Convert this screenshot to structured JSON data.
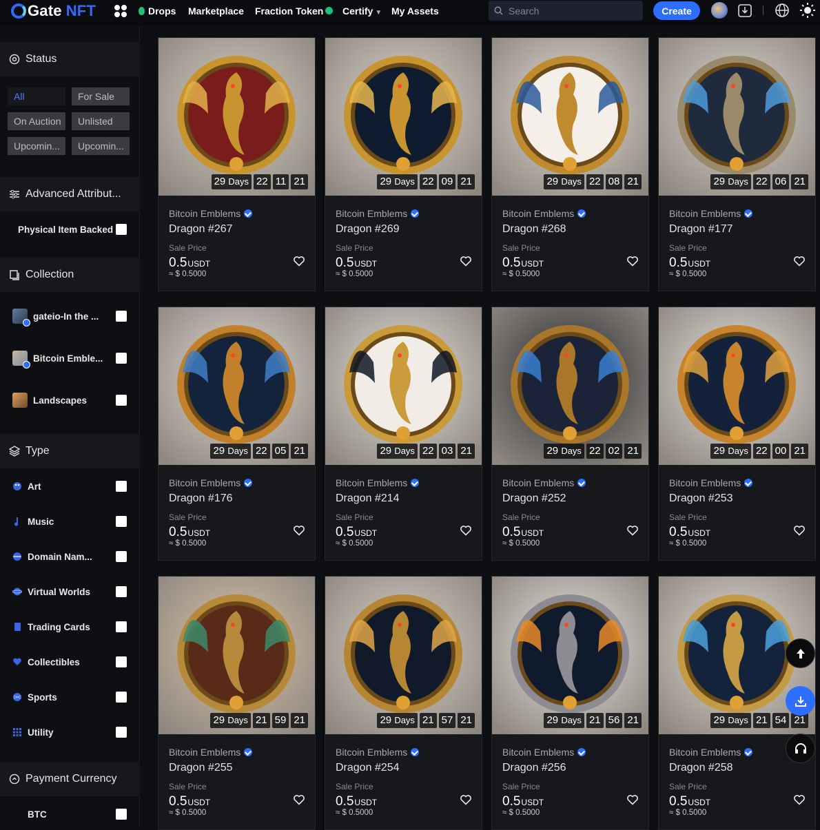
{
  "header": {
    "logo_main": "Gate",
    "logo_sub": "NFT",
    "nav": [
      {
        "label": "Drops"
      },
      {
        "label": "Marketplace"
      },
      {
        "label": "Fraction Token"
      },
      {
        "label": "Certify"
      },
      {
        "label": "My Assets"
      }
    ],
    "search_placeholder": "Search",
    "create_label": "Create"
  },
  "sidebar": {
    "status": {
      "title": "Status",
      "chips": [
        {
          "label": "All",
          "active": true
        },
        {
          "label": "For Sale",
          "active": false
        },
        {
          "label": "On Auction",
          "active": false
        },
        {
          "label": "Unlisted",
          "active": false
        },
        {
          "label": "Upcomin...",
          "active": false
        },
        {
          "label": "Upcomin...",
          "active": false
        }
      ]
    },
    "advanced": {
      "title": "Advanced Attribut...",
      "items": [
        {
          "label": "Physical Item Backed"
        }
      ]
    },
    "collection": {
      "title": "Collection",
      "items": [
        {
          "label": "gateio-In the ..."
        },
        {
          "label": "Bitcoin Emble..."
        },
        {
          "label": "Landscapes"
        }
      ]
    },
    "type": {
      "title": "Type",
      "items": [
        {
          "label": "Art"
        },
        {
          "label": "Music"
        },
        {
          "label": "Domain Nam..."
        },
        {
          "label": "Virtual Worlds"
        },
        {
          "label": "Trading Cards"
        },
        {
          "label": "Collectibles"
        },
        {
          "label": "Sports"
        },
        {
          "label": "Utility"
        }
      ]
    },
    "payment": {
      "title": "Payment Currency",
      "items": [
        {
          "label": "BTC"
        }
      ]
    }
  },
  "cards_common": {
    "collection": "Bitcoin Emblems",
    "sale_label": "Sale Price",
    "price": "0.5",
    "currency": "USDT",
    "usd": "≈ $ 0.5000",
    "days": "29",
    "days_label": "Days"
  },
  "cards": [
    {
      "title": "Dragon #267",
      "h": "22",
      "m": "11",
      "s": "21",
      "palette": "#d7cfc4,#c8942f,#7a1c1c,#e0b04a"
    },
    {
      "title": "Dragon #269",
      "h": "22",
      "m": "09",
      "s": "21",
      "palette": "#ded7ce,#c8942f,#0f1c30,#e6b64c"
    },
    {
      "title": "Dragon #268",
      "h": "22",
      "m": "08",
      "s": "21",
      "palette": "#e2ddd6,#c08a2e,#f4efe8,#2b5b9c"
    },
    {
      "title": "Dragon #177",
      "h": "22",
      "m": "06",
      "s": "21",
      "palette": "#dcd7d1,#9a8a6a,#1f2a3c,#4f9ad8"
    },
    {
      "title": "Dragon #176",
      "h": "22",
      "m": "05",
      "s": "21",
      "palette": "#e0dbd4,#c3802a,#13233b,#3f7fc7"
    },
    {
      "title": "Dragon #214",
      "h": "22",
      "m": "03",
      "s": "21",
      "palette": "#e4e0db,#c99b3a,#f1ede6,#101826"
    },
    {
      "title": "Dragon #252",
      "h": "22",
      "m": "02",
      "s": "21",
      "palette": "#2a2b31,#a8772a,#1a2338,#3b7fd0"
    },
    {
      "title": "Dragon #253",
      "h": "22",
      "m": "00",
      "s": "21",
      "palette": "#e6e2dd,#c8842c,#13213a,#e0a040"
    },
    {
      "title": "Dragon #255",
      "h": "21",
      "m": "59",
      "s": "21",
      "palette": "#dcc3a8,#b7893a,#5a2a18,#3d8a6a"
    },
    {
      "title": "Dragon #254",
      "h": "21",
      "m": "57",
      "s": "21",
      "palette": "#d8d2ca,#b68633,#101a2a,#e1a64a"
    },
    {
      "title": "Dragon #256",
      "h": "21",
      "m": "56",
      "s": "21",
      "palette": "#e8e4df,#8c8c92,#0f1a2c,#e88a2a"
    },
    {
      "title": "Dragon #258",
      "h": "21",
      "m": "54",
      "s": "21",
      "palette": "#e2ddd6,#c49a45,#14233c,#4aa0dc"
    }
  ]
}
